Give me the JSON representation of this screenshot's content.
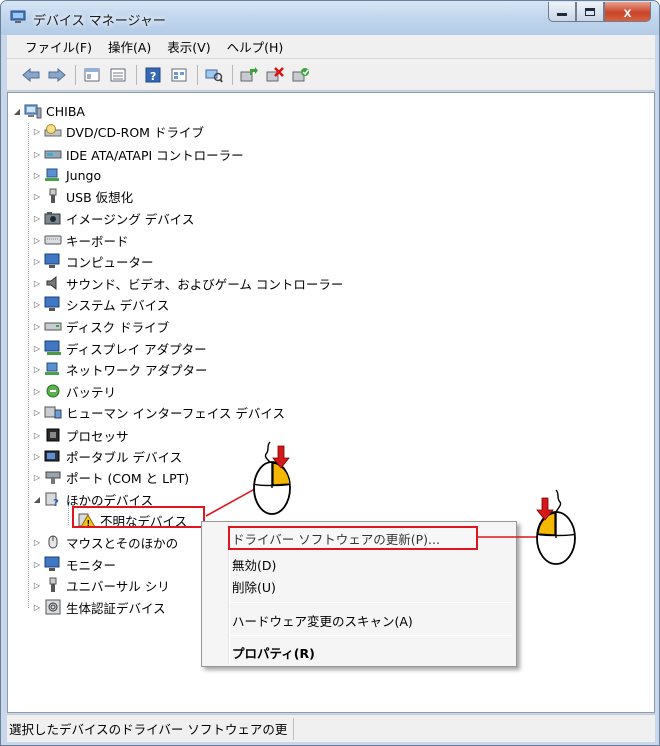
{
  "window": {
    "title": "デバイス マネージャー",
    "close_glyph": "x"
  },
  "menu": [
    "ファイル(F)",
    "操作(A)",
    "表示(V)",
    "ヘルプ(H)"
  ],
  "toolbar_icons": [
    "back-arrow-icon",
    "forward-arrow-icon",
    "properties-icon",
    "view-icon",
    "help-icon",
    "list-icon",
    "scan-icon",
    "update-driver-icon",
    "uninstall-icon",
    "enable-icon"
  ],
  "tree": {
    "root": "CHIBA",
    "items": [
      "DVD/CD-ROM ドライブ",
      "IDE ATA/ATAPI コントローラー",
      "Jungo",
      "USB 仮想化",
      "イメージング デバイス",
      "キーボード",
      "コンピューター",
      "サウンド、ビデオ、およびゲーム コントローラー",
      "システム デバイス",
      "ディスク ドライブ",
      "ディスプレイ アダプター",
      "ネットワーク アダプター",
      "バッテリ",
      "ヒューマン インターフェイス デバイス",
      "プロセッサ",
      "ポータブル デバイス",
      "ポート (COM と LPT)",
      "ほかのデバイス"
    ],
    "child": "不明なデバイス",
    "after": [
      "マウスとそのほかの",
      "モニター",
      "ユニバーサル シリ",
      "生体認証デバイス"
    ]
  },
  "context_menu": {
    "update": "ドライバー ソフトウェアの更新(P)...",
    "disable": "無効(D)",
    "uninstall": "削除(U)",
    "scan": "ハードウェア変更のスキャン(A)",
    "properties": "プロパティ(R)"
  },
  "status": {
    "text": "選択したデバイスのドライバー ソフトウェアの更"
  },
  "colors": {
    "highlight_border": "#e0151e",
    "mouse_button": "#f5b800",
    "arrow": "#d21a1a"
  }
}
